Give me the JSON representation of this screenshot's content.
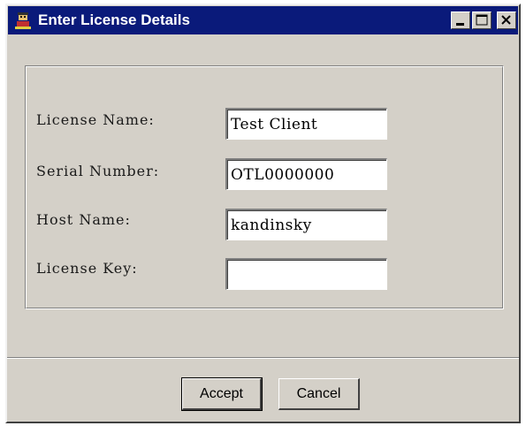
{
  "window": {
    "title": "Enter License Details",
    "title_bar_color": "#0a1a7a",
    "background_color": "#d4d0c8",
    "icon": "app-person-icon"
  },
  "title_buttons": {
    "minimize_icon": "minimize-icon",
    "maximize_icon": "maximize-icon",
    "close_icon": "close-icon"
  },
  "form": {
    "license_name": {
      "label": "License Name:",
      "value": "Test Client"
    },
    "serial_number": {
      "label": "Serial Number:",
      "value": "OTL0000000"
    },
    "host_name": {
      "label": "Host Name:",
      "value": "kandinsky"
    },
    "license_key": {
      "label": "License Key:",
      "value": ""
    }
  },
  "buttons": {
    "accept_label": "Accept",
    "cancel_label": "Cancel"
  }
}
